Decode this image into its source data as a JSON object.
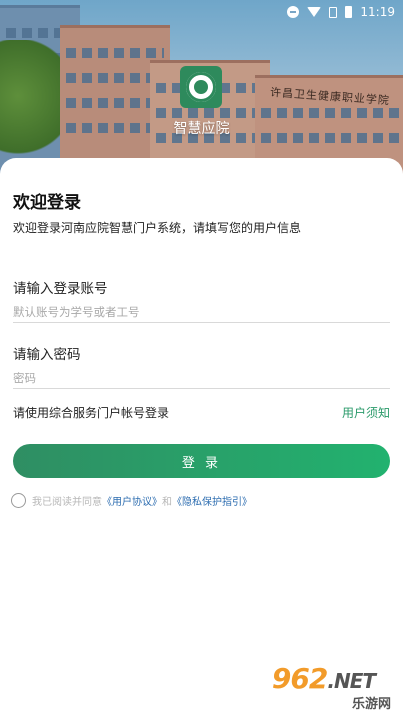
{
  "status_bar": {
    "time": "11:19"
  },
  "banner": {
    "sign_text": "许昌卫生健康职业学院"
  },
  "app": {
    "title": "智慧应院"
  },
  "welcome": {
    "title": "欢迎登录",
    "subtitle": "欢迎登录河南应院智慧门户系统，请填写您的用户信息"
  },
  "account": {
    "label": "请输入登录账号",
    "placeholder": "默认账号为学号或者工号",
    "value": ""
  },
  "password": {
    "label": "请输入密码",
    "placeholder": "密码",
    "value": ""
  },
  "hint": "请使用综合服务门户帐号登录",
  "user_notice": "用户须知",
  "login_button": "登 录",
  "agreement": {
    "prefix": "我已阅读并同意",
    "user_agreement": "《用户协议》",
    "and": "和",
    "privacy": "《隐私保护指引》",
    "checked": false
  },
  "watermark": {
    "num": "962",
    "net": ".NET",
    "cn": "乐游网"
  },
  "colors": {
    "accent": "#2a9a6a",
    "link": "#2d6db0",
    "button_start": "#2f8e63",
    "button_end": "#22b26f"
  },
  "icons": [
    "dnd-icon",
    "wifi-icon",
    "sim-icon",
    "battery-icon",
    "school-logo-icon",
    "radio-icon"
  ]
}
